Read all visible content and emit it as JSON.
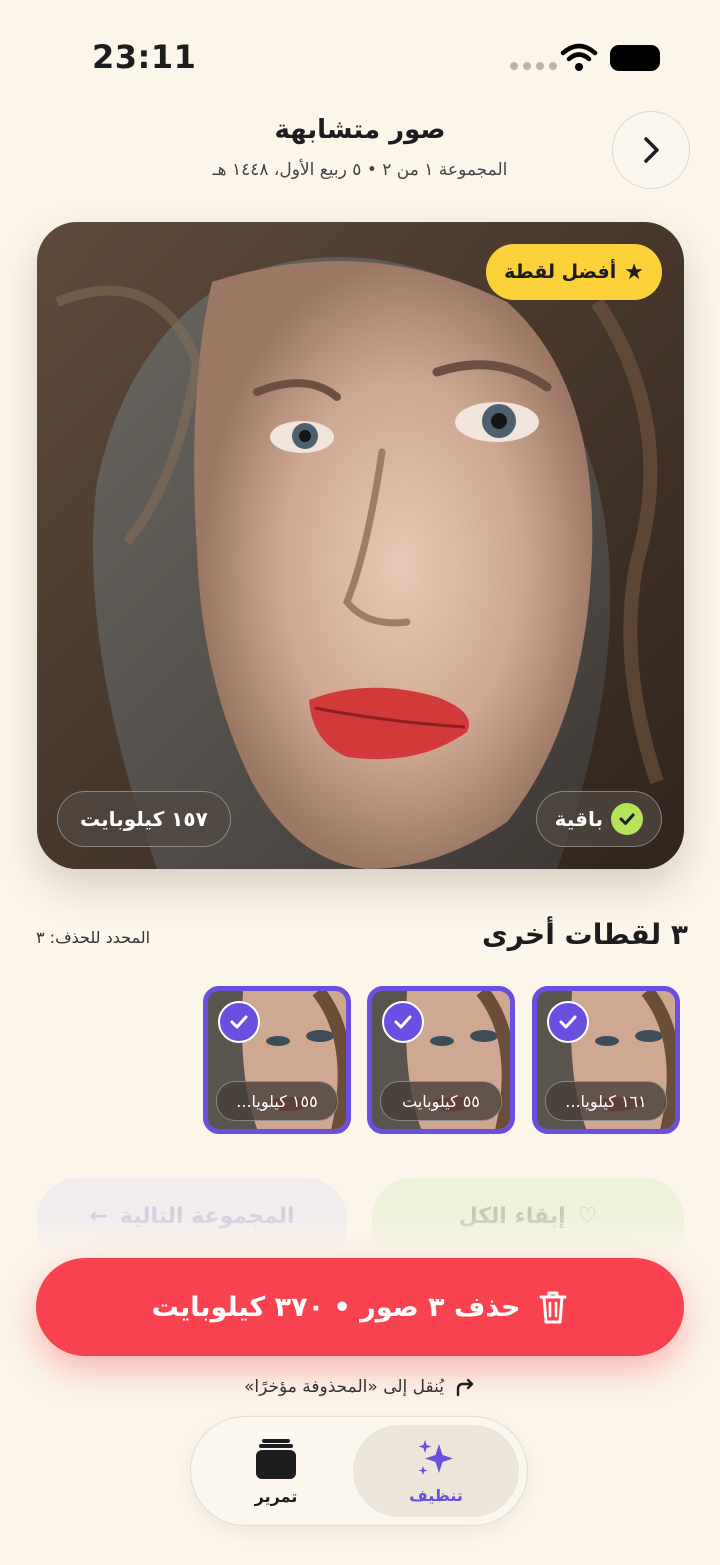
{
  "status_bar": {
    "time": "23:11"
  },
  "header": {
    "title": "صور متشابهة",
    "subtitle": "المجموعة ١ من ٢ • ٥ ربيع الأول، ١٤٤٨ هـ"
  },
  "hero": {
    "best_badge": "أفضل لقطة",
    "kept_label": "باقية",
    "size_label": "١٥٧ كيلوبايت"
  },
  "others": {
    "title": "٣ لقطات أخرى",
    "selected_count": "المحدد للحذف: ٣",
    "thumbnails": [
      {
        "size": "١٦١ كيلويا..."
      },
      {
        "size": "٥٥ كيلوبايت"
      },
      {
        "size": "١٥٥ كيلويا..."
      }
    ]
  },
  "actions": {
    "keep_all": "إبقاء الكل",
    "next_group": "المجموعة التالية",
    "delete": "حذف ٣ صور • ٣٧٠ كيلوبايت",
    "moved_note": "يُنقل إلى «المحذوفة مؤخرًا»"
  },
  "tabbar": {
    "clean": "تنظيف",
    "swipe": "تمرير"
  },
  "colors": {
    "background": "#fbf5ea",
    "accent_purple": "#6a4fe0",
    "delete_red": "#f9424f",
    "best_yellow": "#fbd13a",
    "keep_green": "#b5e35a"
  }
}
